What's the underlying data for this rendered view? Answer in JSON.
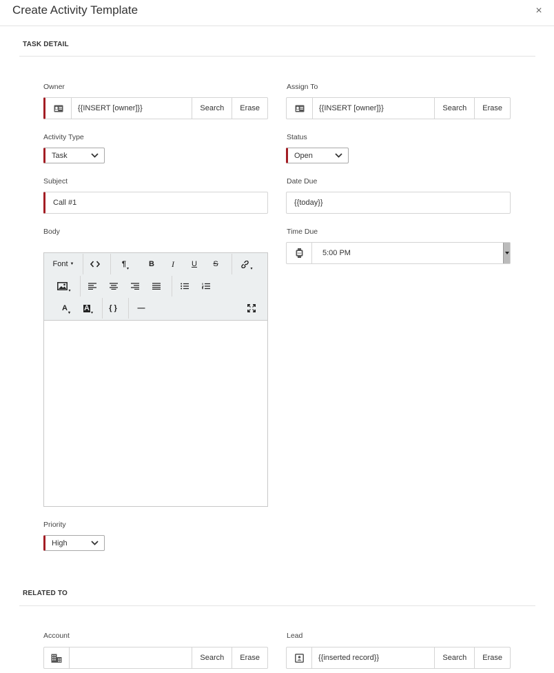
{
  "dialog": {
    "title": "Create Activity Template",
    "close_glyph": "×"
  },
  "task_detail": {
    "section_title": "TASK DETAIL",
    "owner": {
      "label": "Owner",
      "value": "{{INSERT [owner]}}",
      "search": "Search",
      "erase": "Erase",
      "icon": "contact-card-icon"
    },
    "assign_to": {
      "label": "Assign To",
      "value": "{{INSERT [owner]}}",
      "search": "Search",
      "erase": "Erase",
      "icon": "contact-card-icon"
    },
    "activity_type": {
      "label": "Activity Type",
      "value": "Task"
    },
    "status": {
      "label": "Status",
      "value": "Open"
    },
    "subject": {
      "label": "Subject",
      "value": "Call #1"
    },
    "date_due": {
      "label": "Date Due",
      "value": "{{today}}"
    },
    "body": {
      "label": "Body"
    },
    "time_due": {
      "label": "Time Due",
      "value": "5:00 PM",
      "icon": "watch-icon"
    },
    "priority": {
      "label": "Priority",
      "value": "High"
    },
    "editor": {
      "font_label": "Font",
      "paragraph_glyph": "¶",
      "bold_glyph": "B",
      "italic_glyph": "I",
      "underline_glyph": "U",
      "strike_glyph": "S",
      "font_color_glyph": "A",
      "bg_color_glyph": "A",
      "braces_glyph": "{ }",
      "hr_glyph": "—"
    }
  },
  "related_to": {
    "section_title": "RELATED TO",
    "account": {
      "label": "Account",
      "value": "",
      "search": "Search",
      "erase": "Erase",
      "icon": "building-icon"
    },
    "lead": {
      "label": "Lead",
      "value": "{{inserted record}}",
      "search": "Search",
      "erase": "Erase",
      "icon": "contact-book-icon"
    }
  },
  "colors": {
    "required_marker": "#a31d24",
    "toolbar_bg": "#eceff0"
  }
}
